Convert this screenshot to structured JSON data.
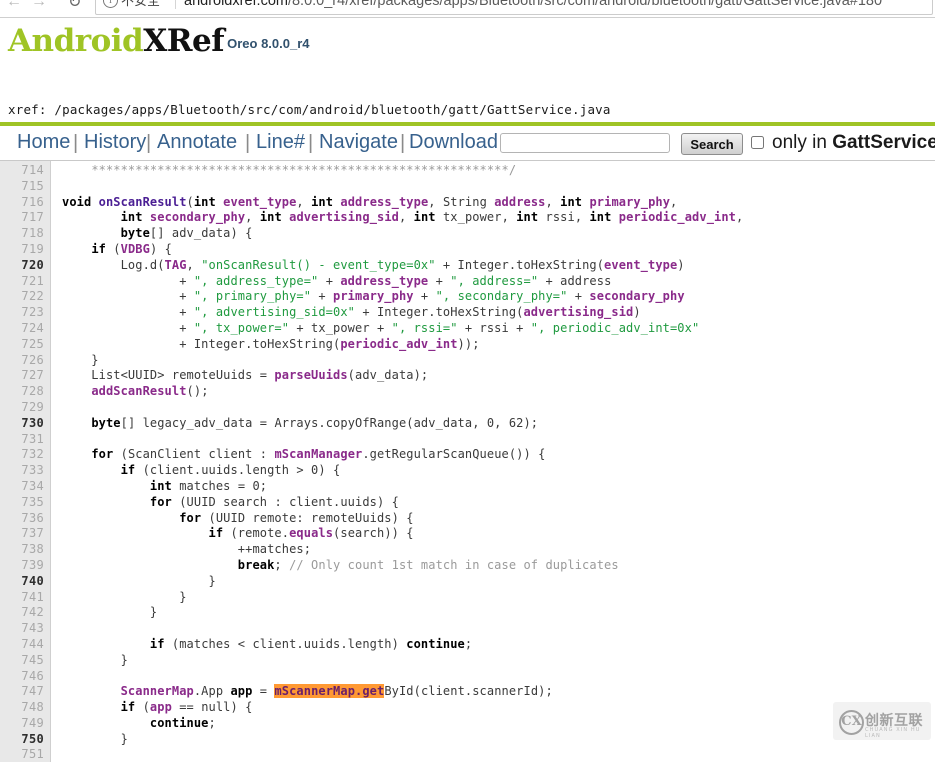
{
  "browser": {
    "back_icon": "back-arrow-icon",
    "forward_icon": "forward-arrow-icon",
    "reload_icon": "reload-icon",
    "info_icon": "info-circle-icon",
    "security_label": "不安全",
    "url_domain": "androidxref.com",
    "url_path": "/8.0.0_r4/xref/packages/apps/Bluetooth/src/com/android/bluetooth/gatt/GattService.java#180"
  },
  "site": {
    "logo_android": "Android",
    "logo_xref": "XRef",
    "logo_version": "Oreo 8.0.0_r4",
    "accent_green": "#9fc425",
    "xref_prefix": "xref:",
    "xref_path": "/packages/apps/Bluetooth/src/com/android/bluetooth/gatt/GattService.java"
  },
  "menu": {
    "home": "Home",
    "history": "History",
    "annotate": "Annotate",
    "line": "Line#",
    "navigate": "Navigate",
    "download": "Download",
    "separator": "|",
    "search_value": "",
    "search_placeholder": "",
    "search_button": "Search",
    "only_in_prefix": "only in ",
    "only_in_file": "GattService"
  },
  "watermark": {
    "mark": "CX",
    "cn": "创新互联",
    "pinyin": "CHUANG XIN HU LIAN"
  },
  "code": {
    "first_line": 714,
    "highlight_color": "#ff9933",
    "lines": [
      {
        "n": 714,
        "tokens": [
          {
            "t": "pl",
            "s": "    "
          },
          {
            "t": "cmt",
            "s": "*********************************************************/"
          }
        ]
      },
      {
        "n": 715,
        "tokens": []
      },
      {
        "n": 716,
        "tokens": [
          {
            "t": "k",
            "s": "void "
          },
          {
            "t": "idb",
            "s": "onScanResult"
          },
          {
            "t": "pl",
            "s": "("
          },
          {
            "t": "k",
            "s": "int "
          },
          {
            "t": "id",
            "s": "event_type"
          },
          {
            "t": "pl",
            "s": ", "
          },
          {
            "t": "k",
            "s": "int "
          },
          {
            "t": "id",
            "s": "address_type"
          },
          {
            "t": "pl",
            "s": ", String "
          },
          {
            "t": "id",
            "s": "address"
          },
          {
            "t": "pl",
            "s": ", "
          },
          {
            "t": "k",
            "s": "int "
          },
          {
            "t": "id",
            "s": "primary_phy"
          },
          {
            "t": "pl",
            "s": ","
          }
        ]
      },
      {
        "n": 717,
        "tokens": [
          {
            "t": "pl",
            "s": "        "
          },
          {
            "t": "k",
            "s": "int "
          },
          {
            "t": "id",
            "s": "secondary_phy"
          },
          {
            "t": "pl",
            "s": ", "
          },
          {
            "t": "k",
            "s": "int "
          },
          {
            "t": "id",
            "s": "advertising_sid"
          },
          {
            "t": "pl",
            "s": ", "
          },
          {
            "t": "k",
            "s": "int "
          },
          {
            "t": "pl",
            "s": "tx_power, "
          },
          {
            "t": "k",
            "s": "int "
          },
          {
            "t": "pl",
            "s": "rssi, "
          },
          {
            "t": "k",
            "s": "int "
          },
          {
            "t": "id",
            "s": "periodic_adv_int"
          },
          {
            "t": "pl",
            "s": ","
          }
        ]
      },
      {
        "n": 718,
        "tokens": [
          {
            "t": "pl",
            "s": "        "
          },
          {
            "t": "k",
            "s": "byte"
          },
          {
            "t": "pl",
            "s": "[] adv_data) {"
          }
        ]
      },
      {
        "n": 719,
        "tokens": [
          {
            "t": "pl",
            "s": "    "
          },
          {
            "t": "k",
            "s": "if "
          },
          {
            "t": "pl",
            "s": "("
          },
          {
            "t": "id",
            "s": "VDBG"
          },
          {
            "t": "pl",
            "s": ") {"
          }
        ]
      },
      {
        "n": 720,
        "tokens": [
          {
            "t": "pl",
            "s": "        Log.d("
          },
          {
            "t": "id",
            "s": "TAG"
          },
          {
            "t": "pl",
            "s": ", "
          },
          {
            "t": "str",
            "s": "\"onScanResult() - event_type=0x\""
          },
          {
            "t": "pl",
            "s": " + Integer.toHexString("
          },
          {
            "t": "id",
            "s": "event_type"
          },
          {
            "t": "pl",
            "s": ")"
          }
        ]
      },
      {
        "n": 721,
        "tokens": [
          {
            "t": "pl",
            "s": "                + "
          },
          {
            "t": "str",
            "s": "\", address_type=\""
          },
          {
            "t": "pl",
            "s": " + "
          },
          {
            "t": "id",
            "s": "address_type"
          },
          {
            "t": "pl",
            "s": " + "
          },
          {
            "t": "str",
            "s": "\", address=\""
          },
          {
            "t": "pl",
            "s": " + address"
          }
        ]
      },
      {
        "n": 722,
        "tokens": [
          {
            "t": "pl",
            "s": "                + "
          },
          {
            "t": "str",
            "s": "\", primary_phy=\""
          },
          {
            "t": "pl",
            "s": " + "
          },
          {
            "t": "id",
            "s": "primary_phy"
          },
          {
            "t": "pl",
            "s": " + "
          },
          {
            "t": "str",
            "s": "\", secondary_phy=\""
          },
          {
            "t": "pl",
            "s": " + "
          },
          {
            "t": "id",
            "s": "secondary_phy"
          }
        ]
      },
      {
        "n": 723,
        "tokens": [
          {
            "t": "pl",
            "s": "                + "
          },
          {
            "t": "str",
            "s": "\", advertising_sid=0x\""
          },
          {
            "t": "pl",
            "s": " + Integer.toHexString("
          },
          {
            "t": "id",
            "s": "advertising_sid"
          },
          {
            "t": "pl",
            "s": ")"
          }
        ]
      },
      {
        "n": 724,
        "tokens": [
          {
            "t": "pl",
            "s": "                + "
          },
          {
            "t": "str",
            "s": "\", tx_power=\""
          },
          {
            "t": "pl",
            "s": " + tx_power + "
          },
          {
            "t": "str",
            "s": "\", rssi=\""
          },
          {
            "t": "pl",
            "s": " + rssi + "
          },
          {
            "t": "str",
            "s": "\", periodic_adv_int=0x\""
          }
        ]
      },
      {
        "n": 725,
        "tokens": [
          {
            "t": "pl",
            "s": "                + Integer.toHexString("
          },
          {
            "t": "id",
            "s": "periodic_adv_int"
          },
          {
            "t": "pl",
            "s": "));"
          }
        ]
      },
      {
        "n": 726,
        "tokens": [
          {
            "t": "pl",
            "s": "    }"
          }
        ]
      },
      {
        "n": 727,
        "tokens": [
          {
            "t": "pl",
            "s": "    List<UUID> remoteUuids = "
          },
          {
            "t": "id",
            "s": "parseUuids"
          },
          {
            "t": "pl",
            "s": "(adv_data);"
          }
        ]
      },
      {
        "n": 728,
        "tokens": [
          {
            "t": "pl",
            "s": "    "
          },
          {
            "t": "id",
            "s": "addScanResult"
          },
          {
            "t": "pl",
            "s": "();"
          }
        ]
      },
      {
        "n": 729,
        "tokens": []
      },
      {
        "n": 730,
        "tokens": [
          {
            "t": "pl",
            "s": "    "
          },
          {
            "t": "k",
            "s": "byte"
          },
          {
            "t": "pl",
            "s": "[] legacy_adv_data = Arrays.copyOfRange(adv_data, 0, 62);"
          }
        ]
      },
      {
        "n": 731,
        "tokens": []
      },
      {
        "n": 732,
        "tokens": [
          {
            "t": "pl",
            "s": "    "
          },
          {
            "t": "k",
            "s": "for "
          },
          {
            "t": "pl",
            "s": "(ScanClient client : "
          },
          {
            "t": "id",
            "s": "mScanManager"
          },
          {
            "t": "pl",
            "s": ".getRegularScanQueue()) {"
          }
        ]
      },
      {
        "n": 733,
        "tokens": [
          {
            "t": "pl",
            "s": "        "
          },
          {
            "t": "k",
            "s": "if "
          },
          {
            "t": "pl",
            "s": "(client.uuids.length > 0) {"
          }
        ]
      },
      {
        "n": 734,
        "tokens": [
          {
            "t": "pl",
            "s": "            "
          },
          {
            "t": "k",
            "s": "int "
          },
          {
            "t": "pl",
            "s": "matches = 0;"
          }
        ]
      },
      {
        "n": 735,
        "tokens": [
          {
            "t": "pl",
            "s": "            "
          },
          {
            "t": "k",
            "s": "for "
          },
          {
            "t": "pl",
            "s": "(UUID search : client.uuids) {"
          }
        ]
      },
      {
        "n": 736,
        "tokens": [
          {
            "t": "pl",
            "s": "                "
          },
          {
            "t": "k",
            "s": "for "
          },
          {
            "t": "pl",
            "s": "(UUID remote: remoteUuids) {"
          }
        ]
      },
      {
        "n": 737,
        "tokens": [
          {
            "t": "pl",
            "s": "                    "
          },
          {
            "t": "k",
            "s": "if "
          },
          {
            "t": "pl",
            "s": "(remote."
          },
          {
            "t": "id",
            "s": "equals"
          },
          {
            "t": "pl",
            "s": "(search)) {"
          }
        ]
      },
      {
        "n": 738,
        "tokens": [
          {
            "t": "pl",
            "s": "                        ++matches;"
          }
        ]
      },
      {
        "n": 739,
        "tokens": [
          {
            "t": "pl",
            "s": "                        "
          },
          {
            "t": "k",
            "s": "break"
          },
          {
            "t": "pl",
            "s": "; "
          },
          {
            "t": "cmt",
            "s": "// Only count 1st match in case of duplicates"
          }
        ]
      },
      {
        "n": 740,
        "tokens": [
          {
            "t": "pl",
            "s": "                    }"
          }
        ]
      },
      {
        "n": 741,
        "tokens": [
          {
            "t": "pl",
            "s": "                }"
          }
        ]
      },
      {
        "n": 742,
        "tokens": [
          {
            "t": "pl",
            "s": "            }"
          }
        ]
      },
      {
        "n": 743,
        "tokens": []
      },
      {
        "n": 744,
        "tokens": [
          {
            "t": "pl",
            "s": "            "
          },
          {
            "t": "k",
            "s": "if "
          },
          {
            "t": "pl",
            "s": "(matches < client.uuids.length) "
          },
          {
            "t": "k",
            "s": "continue"
          },
          {
            "t": "pl",
            "s": ";"
          }
        ]
      },
      {
        "n": 745,
        "tokens": [
          {
            "t": "pl",
            "s": "        }"
          }
        ]
      },
      {
        "n": 746,
        "tokens": []
      },
      {
        "n": 747,
        "tokens": [
          {
            "t": "pl",
            "s": "        "
          },
          {
            "t": "id",
            "s": "ScannerMap"
          },
          {
            "t": "pl",
            "s": ".App "
          },
          {
            "t": "k",
            "s": "app"
          },
          {
            "t": "pl",
            "s": " = "
          },
          {
            "t": "hl",
            "s": "mScannerMap.get"
          },
          {
            "t": "pl",
            "s": "ById(client.scannerId);"
          }
        ]
      },
      {
        "n": 748,
        "tokens": [
          {
            "t": "pl",
            "s": "        "
          },
          {
            "t": "k",
            "s": "if "
          },
          {
            "t": "pl",
            "s": "("
          },
          {
            "t": "id",
            "s": "app"
          },
          {
            "t": "pl",
            "s": " == null) {"
          }
        ]
      },
      {
        "n": 749,
        "tokens": [
          {
            "t": "pl",
            "s": "            "
          },
          {
            "t": "k",
            "s": "continue"
          },
          {
            "t": "pl",
            "s": ";"
          }
        ]
      },
      {
        "n": 750,
        "tokens": [
          {
            "t": "pl",
            "s": "        }"
          }
        ]
      },
      {
        "n": 751,
        "tokens": []
      }
    ]
  }
}
